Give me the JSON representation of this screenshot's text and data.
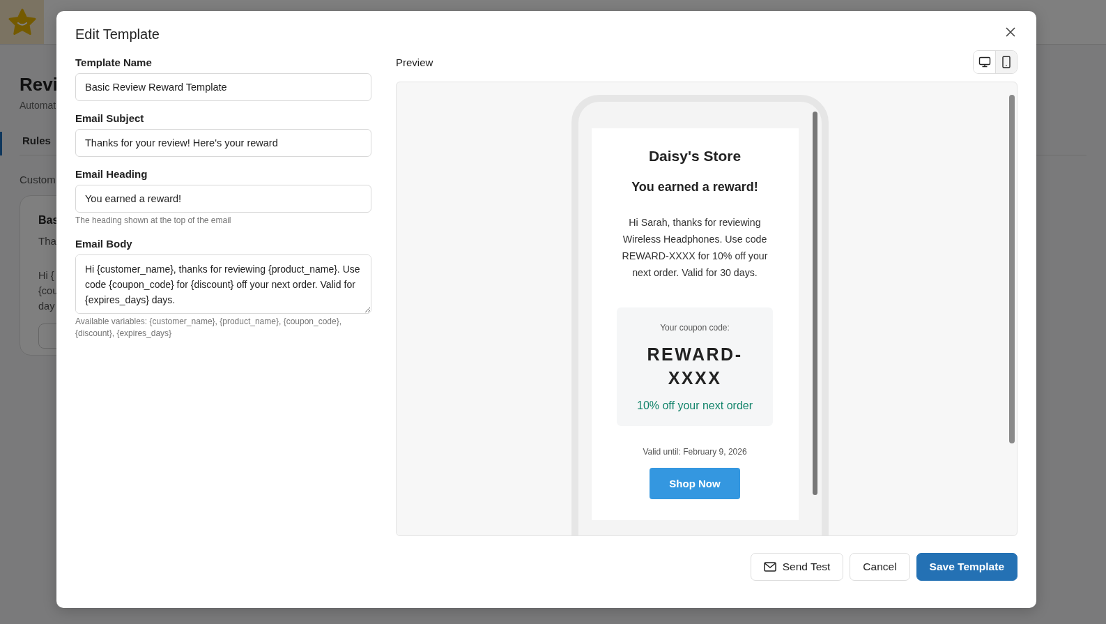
{
  "background": {
    "title": "Revi",
    "subtitle": "Automat",
    "tab": "Rules",
    "section": "Custom",
    "card_title": "Bas",
    "card_subtitle": "Tha",
    "card_body": [
      "Hi {",
      "{cou",
      "day"
    ]
  },
  "modal": {
    "title": "Edit Template",
    "fields": [
      {
        "kind": "input",
        "label": "Template Name",
        "value": "Basic Review Reward Template"
      },
      {
        "kind": "input",
        "label": "Email Subject",
        "value": "Thanks for your review! Here's your reward"
      },
      {
        "kind": "input",
        "label": "Email Heading",
        "value": "You earned a reward!",
        "help": "The heading shown at the top of the email"
      },
      {
        "kind": "textarea",
        "label": "Email Body",
        "value": "Hi {customer_name}, thanks for reviewing {product_name}. Use code {coupon_code} for {discount} off your next order. Valid for {expires_days} days.",
        "help": "Available variables: {customer_name}, {product_name}, {coupon_code}, {discount}, {expires_days}"
      }
    ],
    "preview": {
      "label": "Preview",
      "devices": [
        {
          "kind": "desktop",
          "selected": false
        },
        {
          "kind": "mobile",
          "selected": true
        }
      ],
      "email": {
        "store_name": "Daisy's Store",
        "heading": "You earned a reward!",
        "body": "Hi Sarah, thanks for reviewing Wireless Headphones. Use code REWARD-XXXX for 10% off your next order. Valid for 30 days.",
        "coupon_label": "Your coupon code:",
        "coupon_code": "REWARD-XXXX",
        "coupon_offer": "10% off your next order",
        "valid_until": "Valid until: February 9, 2026",
        "button": "Shop Now"
      }
    },
    "buttons": [
      {
        "kind": "mail",
        "label": "Send Test"
      },
      {
        "kind": "plain",
        "label": "Cancel"
      },
      {
        "kind": "primary",
        "label": "Save Template"
      }
    ]
  }
}
